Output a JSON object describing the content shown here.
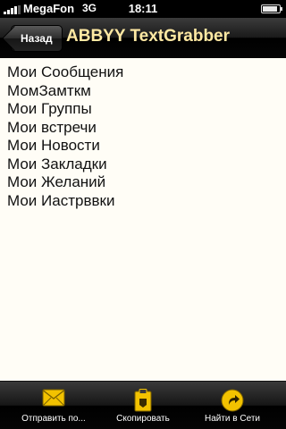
{
  "status_bar": {
    "carrier": "MegaFon",
    "network": "3G",
    "time": "18:11",
    "battery_level": 0.9
  },
  "nav": {
    "back_label": "Назад",
    "title": "ABBYY TextGrabber"
  },
  "content": {
    "lines": [
      "Мои Сообщения",
      "МомЗамткм",
      "Мои Группы",
      "Мои встречи",
      "Мои Новости",
      "Мои Закладки",
      "Мои Желаний",
      "Мои Иастрввки"
    ]
  },
  "toolbar": {
    "items": [
      {
        "label": "Отправить по...",
        "icon": "envelope-icon"
      },
      {
        "label": "Скопировать",
        "icon": "clipboard-icon"
      },
      {
        "label": "Найти в Сети",
        "icon": "globe-arrow-icon"
      }
    ]
  },
  "colors": {
    "accent_yellow": "#ffe9a3",
    "icon_yellow": "#f2c200",
    "content_background": "#fffdf6"
  }
}
